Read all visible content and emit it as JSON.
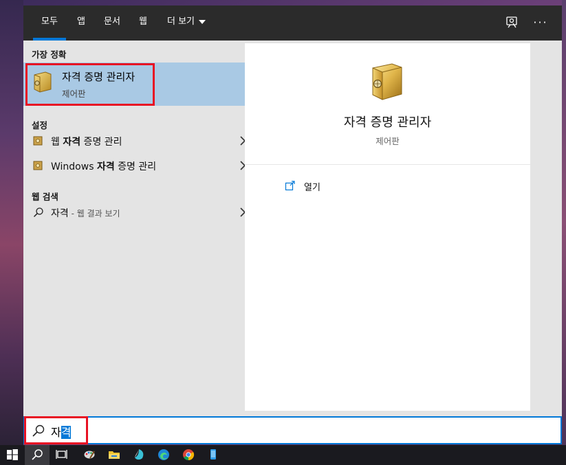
{
  "tabs": [
    {
      "label": "모두",
      "active": true
    },
    {
      "label": "앱"
    },
    {
      "label": "문서"
    },
    {
      "label": "웹"
    },
    {
      "label": "더 보기"
    }
  ],
  "top_icons": [
    "feedback-icon",
    "more-options-icon"
  ],
  "more_label": "···",
  "best_match": {
    "header": "가장 정확",
    "title": "자격 증명 관리자",
    "subtitle": "제어판"
  },
  "settings": {
    "header": "설정",
    "items": [
      {
        "pre": "웹 ",
        "bold": "자격",
        "post": " 증명 관리"
      },
      {
        "pre": "Windows ",
        "bold": "자격",
        "post": " 증명 관리"
      }
    ]
  },
  "web_search": {
    "header": "웹 검색",
    "query": "자격",
    "suffix": " - 웹 결과 보기"
  },
  "detail": {
    "title": "자격 증명 관리자",
    "subtitle": "제어판",
    "open_label": "열기"
  },
  "search_box": {
    "typed": "자",
    "selected": "격"
  },
  "colors": {
    "accent": "#0078d7",
    "highlight": "#a9c9e4",
    "annotation": "#e81123",
    "topbar": "#2b2b2b"
  },
  "taskbar_icons": [
    "windows-start-icon",
    "search-icon",
    "task-view-icon",
    "paint-icon",
    "file-explorer-icon",
    "app-icon",
    "edge-icon",
    "chrome-icon",
    "phone-icon"
  ]
}
